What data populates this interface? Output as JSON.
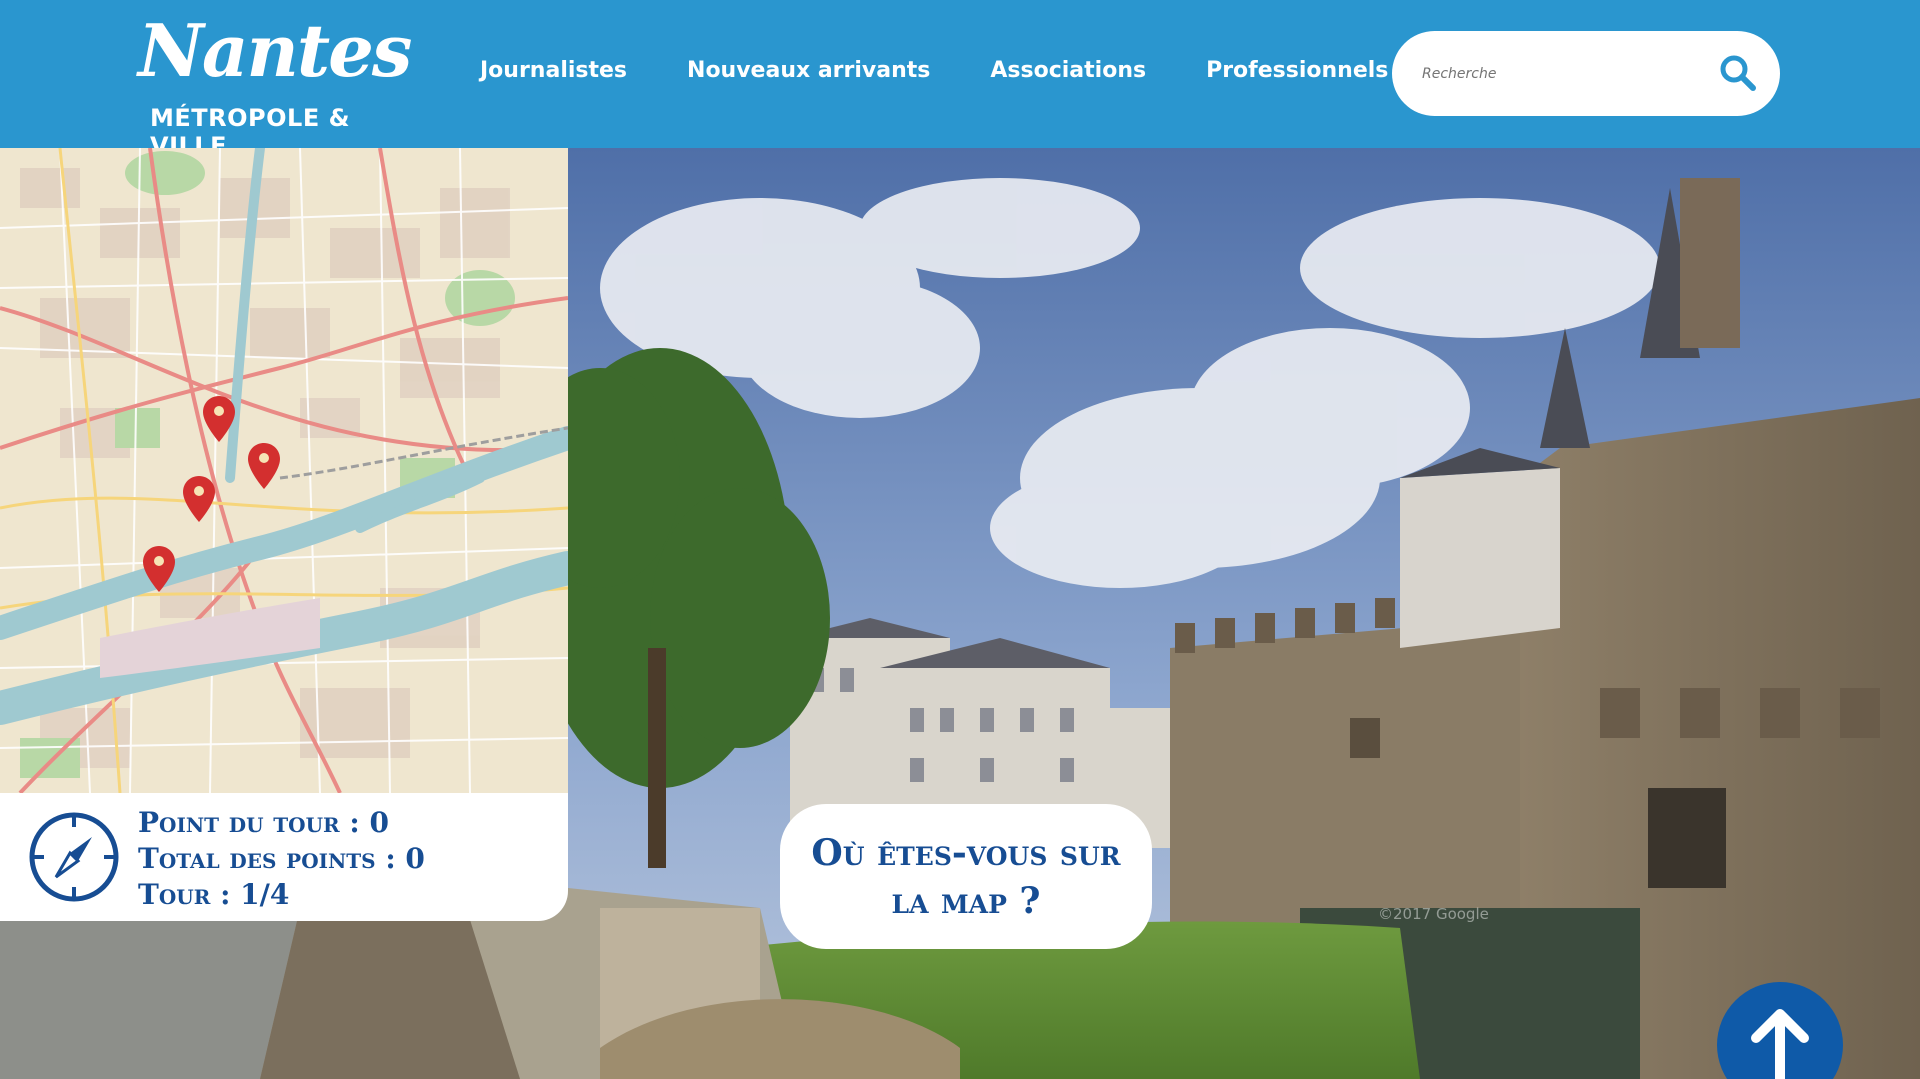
{
  "header": {
    "logo_word": "Nantes",
    "logo_sub": "MÉTROPOLE & VILLE",
    "nav": [
      {
        "label": "Journalistes"
      },
      {
        "label": "Nouveaux arrivants"
      },
      {
        "label": "Associations"
      },
      {
        "label": "Professionnels"
      }
    ],
    "search_placeholder": "Recherche",
    "icons": {
      "search": "search-icon"
    }
  },
  "photo": {
    "watermark": "©2017 Google"
  },
  "map": {
    "marker_count": 4
  },
  "score": {
    "tour_points": "Point du tour : 0",
    "total_points": "Total des points : 0",
    "tour": "Tour : 1/4"
  },
  "question": {
    "text": "Où êtes-vous sur la map ?"
  },
  "colors": {
    "header": "#2a96cf",
    "brand_dark": "#174d93",
    "marker": "#d32f2f",
    "river": "#9fc9d0"
  }
}
